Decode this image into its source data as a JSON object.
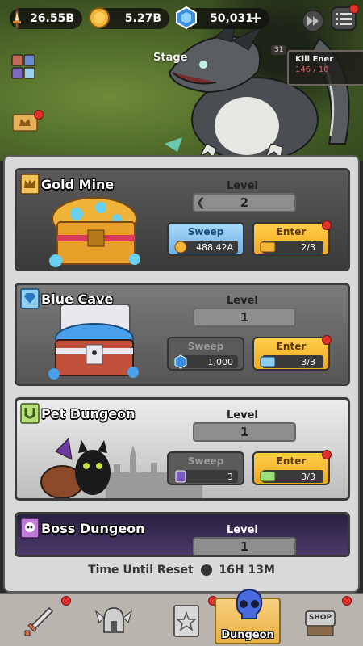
{
  "currency": {
    "power": "26.55B",
    "gold": "5.27B",
    "gems": "50,031"
  },
  "stage": {
    "label": "Stage",
    "kill_label": "Kill Ener",
    "kill_progress": "146 / 10",
    "badge": "31"
  },
  "dungeons": [
    {
      "title": "Gold Mine",
      "level_label": "Level",
      "level": "2",
      "sweep_label": "Sweep",
      "sweep_cost": "488.42A",
      "enter_label": "Enter",
      "enter_count": "2/3",
      "sweep_enabled": true
    },
    {
      "title": "Blue Cave",
      "level_label": "Level",
      "level": "1",
      "sweep_label": "Sweep",
      "sweep_cost": "1,000",
      "enter_label": "Enter",
      "enter_count": "3/3",
      "sweep_enabled": false
    },
    {
      "title": "Pet Dungeon",
      "level_label": "Level",
      "level": "1",
      "sweep_label": "Sweep",
      "sweep_cost": "3",
      "enter_label": "Enter",
      "enter_count": "3/3",
      "sweep_enabled": false
    },
    {
      "title": "Boss Dungeon",
      "level_label": "Level",
      "level": "1"
    }
  ],
  "reset": {
    "label": "Time Until Reset",
    "time": "16H 13M"
  },
  "nav": {
    "dungeon_label": "Dungeon",
    "shop_label": "SHOP"
  },
  "colors": {
    "accent_gold": "#f0a91f",
    "sweep_blue": "#8fc6ee",
    "notification_red": "#e0312b"
  }
}
